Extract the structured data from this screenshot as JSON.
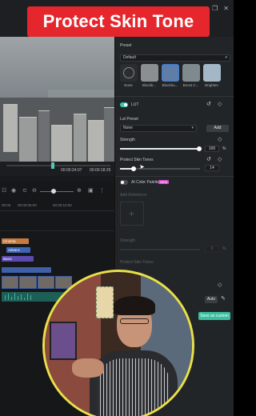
{
  "banner": {
    "title": "Protect Skin Tone"
  },
  "window": {
    "minimize_icon": "minimize-icon",
    "restore_icon": "restore-icon",
    "close_icon": "close-icon"
  },
  "player": {
    "current_time": "00:00:24:07",
    "total_time": "00:00:18:25"
  },
  "timeline": {
    "ruler": [
      "00:00",
      "00:00:05:00",
      "00:00:10:00"
    ],
    "clips": {
      "title_clip": "Cinema",
      "effect_clip": "Advanc",
      "text_clip": "Basic"
    }
  },
  "panel": {
    "preset_label": "Preset",
    "preset_select": "Default",
    "presets": [
      "None",
      "Blockb...",
      "Blockbu...",
      "Boost C...",
      "Brighten"
    ],
    "lut_label": "LUT",
    "lut_enabled": true,
    "lut_preset_label": "Lut Preset",
    "lut_preset_value": "None",
    "add_button": "Add",
    "strength_label": "Strength",
    "strength_value": "100",
    "strength_unit": "%",
    "protect_skin_label": "Protect Skin Tones",
    "protect_skin_value": "14",
    "ai_palette_label": "AI Color Palette",
    "ai_palette_enabled": false,
    "ai_badge": "NEW",
    "add_reference_label": "Add Reference",
    "ai_strength_label": "Strength",
    "ai_strength_value": "0",
    "ai_strength_unit": "%",
    "ai_protect_label": "Protect Skin Tones",
    "auto_button": "Auto",
    "save_button": "Save as custom"
  },
  "colors": {
    "accent": "#3dc7ae",
    "banner_bg": "#e5262c",
    "webcam_border": "#e9e04a"
  }
}
